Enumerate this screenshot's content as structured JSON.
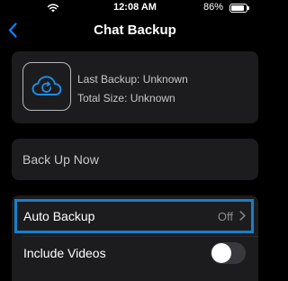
{
  "status_bar": {
    "time": "12:08 AM",
    "battery_percent": "86%",
    "battery_level": 0.86,
    "wifi_icon": "wifi-icon",
    "battery_icon": "battery-icon"
  },
  "nav": {
    "title": "Chat Backup",
    "back_icon": "chevron-left-icon"
  },
  "backup_info": {
    "icon": "cloud-refresh-icon",
    "last_backup": "Last Backup: Unknown",
    "total_size": "Total Size: Unknown"
  },
  "actions": {
    "back_up_now": "Back Up Now"
  },
  "settings": {
    "auto_backup": {
      "label": "Auto Backup",
      "value": "Off",
      "chevron_icon": "chevron-right-icon",
      "highlighted": true
    },
    "include_videos": {
      "label": "Include Videos",
      "enabled": false
    }
  },
  "colors": {
    "background": "#000000",
    "card": "#1c1c1e",
    "accent": "#0a84ff",
    "highlight_border": "#1a7fc8",
    "secondary_text": "#8e8e93"
  }
}
